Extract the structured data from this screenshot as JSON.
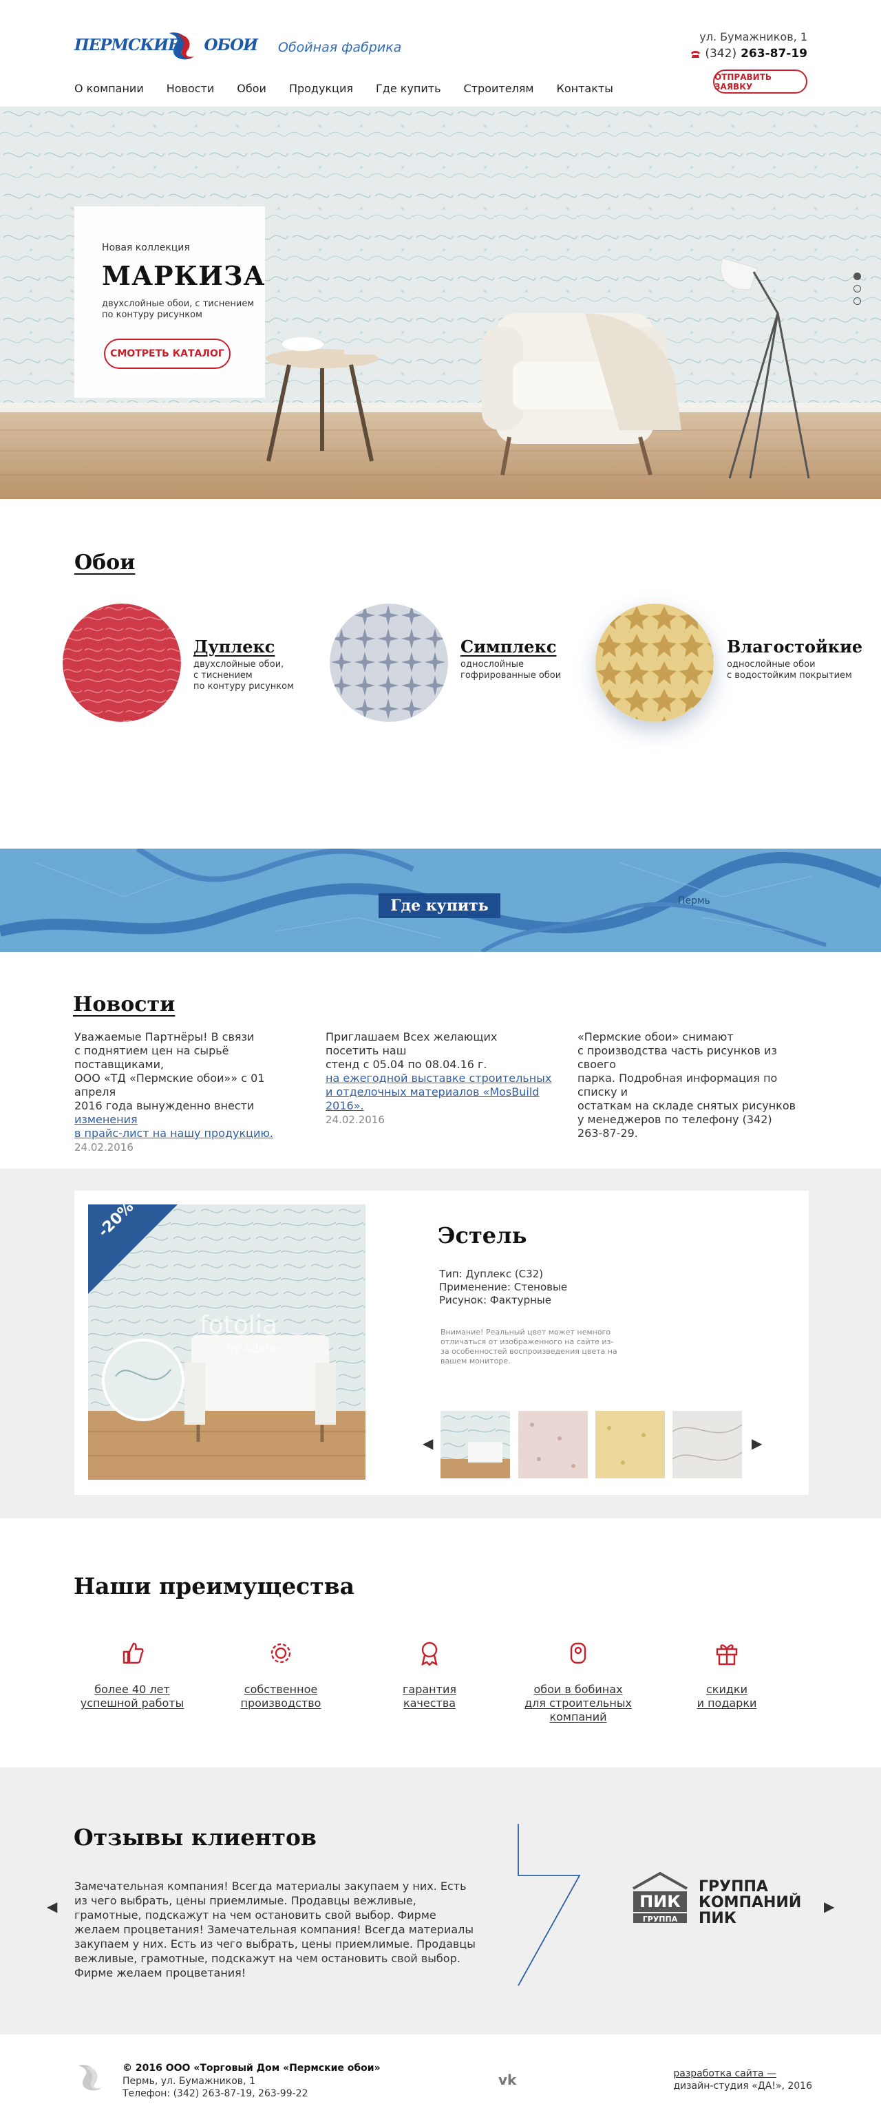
{
  "brand": {
    "logo_word1": "ПЕРМСКИЕ",
    "logo_word2": "ОБОИ",
    "tagline": "Обойная фабрика",
    "accent": "#c8202b",
    "blue": "#1c5aa6"
  },
  "header": {
    "address": "ул. Бумажников, 1",
    "phone_code": "(342)",
    "phone_number": "263-87-19",
    "send_label": "ОТПРАВИТЬ ЗАЯВКУ"
  },
  "nav": [
    "О компании",
    "Новости",
    "Обои",
    "Продукция",
    "Где купить",
    "Строителям",
    "Контакты"
  ],
  "hero": {
    "kicker": "Новая коллекция",
    "title": "МАРКИЗА",
    "desc_line1": "двухслойные обои, с тиснением",
    "desc_line2": "по контуру рисунком",
    "catalog_label": "СМОТРЕТЬ КАТАЛОГ"
  },
  "wallpapers": {
    "heading": "Обои",
    "items": [
      {
        "name": "Дуплекс",
        "desc": [
          "двухслойные обои,",
          "с тиснением",
          "по контуру рисунком"
        ]
      },
      {
        "name": "Симплекс",
        "desc": [
          "однослойные",
          "гофрированные обои"
        ]
      },
      {
        "name": "Влагостойкие",
        "desc": [
          "однослойные обои",
          "с водостойким покрытием"
        ]
      }
    ]
  },
  "map": {
    "button": "Где купить",
    "city_label": "Пермь"
  },
  "news": {
    "heading": "Новости",
    "items": [
      {
        "lines": [
          "Уважаемые Партнёры! В связи",
          "с поднятием цен на сырьё поставщиками,",
          "ООО «ТД «Пермские обои»» с 01 апреля",
          "2016 года вынужденно внести "
        ],
        "link": [
          "изменения",
          "в прайс-лист на нашу продукцию."
        ],
        "date": "24.02.2016"
      },
      {
        "lines": [
          "Приглашаем Всех желающих посетить наш",
          "стенд с 05.04 по 08.04.16 г."
        ],
        "link": [
          "на ежегодной выставке строительных",
          "и отделочных материалов «MosBuild 2016»."
        ],
        "date": "24.02.2016"
      },
      {
        "lines": [
          "«Пермские обои» снимают",
          "с производства часть рисунков из своего",
          "парка. Подробная информация по списку и",
          "остаткам на складе снятых рисунков",
          "у менеджеров по телефону (342)",
          "263-87-29."
        ],
        "link": [],
        "date": ""
      }
    ]
  },
  "product": {
    "discount": "-20%",
    "watermark1": "fotolia",
    "watermark2": "by Adobe",
    "title": "Эстель",
    "type": "Тип: Дуплекс (С32)",
    "usage": "Применение: Стеновые",
    "pattern": "Рисунок: Фактурные",
    "note": "Внимание! Реальный цвет может немного отличаться от изображенного на сайте из-за особенностей воспроизведения цвета на вашем мониторе."
  },
  "advantages": {
    "heading": "Наши преимущества",
    "items": [
      {
        "icon": "thumbs-up-icon",
        "lines": [
          "более 40 лет",
          "успешной работы"
        ]
      },
      {
        "icon": "gear-icon",
        "lines": [
          "собственное",
          "производство"
        ]
      },
      {
        "icon": "award-icon",
        "lines": [
          "гарантия",
          "качества"
        ]
      },
      {
        "icon": "roll-icon",
        "lines": [
          "обои в бобинах",
          "для строительных",
          "компаний"
        ]
      },
      {
        "icon": "gift-icon",
        "lines": [
          "скидки",
          "и подарки"
        ]
      }
    ]
  },
  "reviews": {
    "heading": "Отзывы клиентов",
    "text": "Замечательная компания! Всегда материалы закупаем у них. Есть из чего выбрать, цены приемлимые. Продавцы вежливые, грамотные, подскажут на чем остановить свой выбор. Фирме желаем процветания! Замечательная компания! Всегда материалы закупаем у них. Есть из чего выбрать, цены приемлимые. Продавцы вежливые, грамотные, подскажут на чем остановить свой выбор. Фирме желаем процветания!",
    "client_logo_top": "ПИК",
    "client_logo_bottom": "ГРУППА",
    "client_name": [
      "ГРУППА",
      "КОМПАНИЙ",
      "ПИК"
    ]
  },
  "footer": {
    "copyright": "© 2016 ООО «Торговый Дом «Пермские обои»",
    "address": "Пермь, ул. Бумажников, 1",
    "phones": "Телефон: (342) 263-87-19, 263-99-22",
    "dev_link": "разработка сайта —",
    "dev_name": "дизайн-студия «ДА!», 2016"
  }
}
